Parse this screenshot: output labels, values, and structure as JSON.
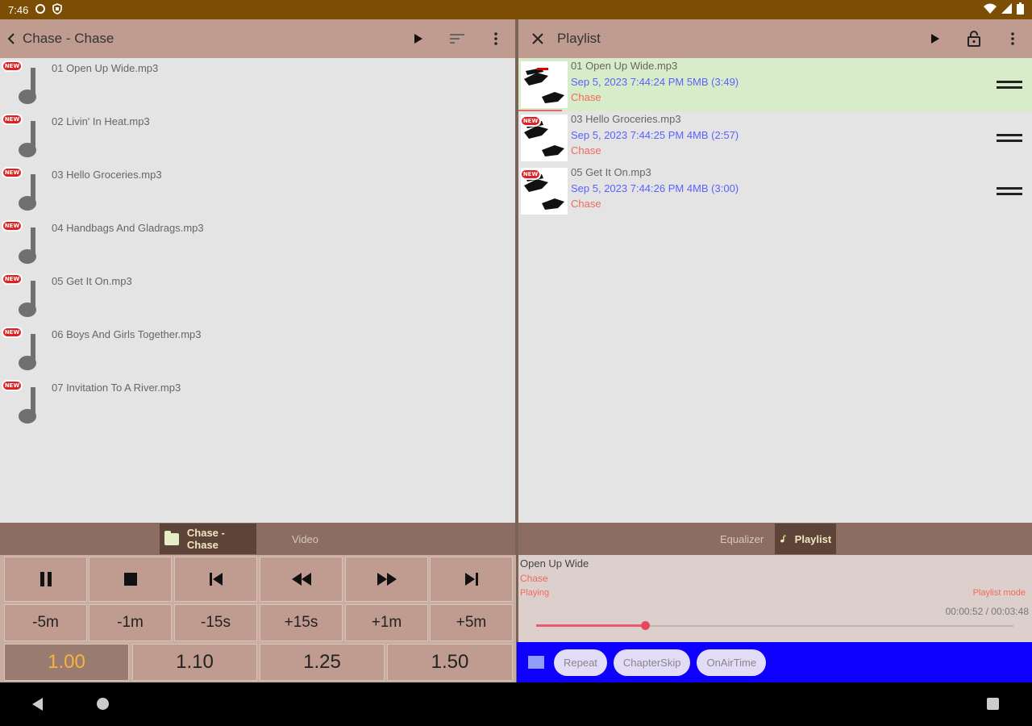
{
  "status_bar": {
    "time": "7:46"
  },
  "left_pane": {
    "title": "Chase - Chase",
    "tracks": [
      {
        "name": "01 Open Up Wide.mp3",
        "badge": "NEW"
      },
      {
        "name": "02 Livin' In Heat.mp3",
        "badge": "NEW"
      },
      {
        "name": "03 Hello Groceries.mp3",
        "badge": "NEW"
      },
      {
        "name": "04 Handbags And Gladrags.mp3",
        "badge": "NEW"
      },
      {
        "name": "05 Get It On.mp3",
        "badge": "NEW"
      },
      {
        "name": "06 Boys And Girls Together.mp3",
        "badge": "NEW"
      },
      {
        "name": "07 Invitation To A River.mp3",
        "badge": "NEW"
      }
    ],
    "tabs": [
      {
        "label": "Chase - Chase",
        "active": true
      },
      {
        "label": "Video",
        "active": false
      }
    ]
  },
  "right_pane": {
    "title": "Playlist",
    "items": [
      {
        "name": "01 Open Up Wide.mp3",
        "meta": "Sep 5, 2023 7:44:24 PM 5MB (3:49)",
        "artist": "Chase",
        "current": true,
        "badge": ""
      },
      {
        "name": "03 Hello Groceries.mp3",
        "meta": "Sep 5, 2023 7:44:25 PM 4MB (2:57)",
        "artist": "Chase",
        "current": false,
        "badge": "NEW"
      },
      {
        "name": "05 Get It On.mp3",
        "meta": "Sep 5, 2023 7:44:26 PM 4MB (3:00)",
        "artist": "Chase",
        "current": false,
        "badge": "NEW"
      }
    ],
    "tabs": [
      {
        "label": "Equalizer",
        "active": false
      },
      {
        "label": "Playlist",
        "active": true
      }
    ]
  },
  "controls": {
    "skip": [
      "-5m",
      "-1m",
      "-15s",
      "+15s",
      "+1m",
      "+5m"
    ],
    "speeds": [
      "1.00",
      "1.10",
      "1.25",
      "1.50"
    ],
    "active_speed": "1.00"
  },
  "player": {
    "song": "Open Up Wide",
    "artist": "Chase",
    "status": "Playing",
    "mode": "Playlist mode",
    "time": "00:00:52 / 00:03:48",
    "progress": 0.2281
  },
  "chips": [
    "Repeat",
    "ChapterSkip",
    "OnAirTime"
  ],
  "colors": {
    "status_bar": "#7c4e05",
    "toolbar": "#c09c90",
    "current_row": "#d9ecc9",
    "chip_bar": "#0e00ff",
    "accent_red": "#ef6a5a",
    "meta_blue": "#5a62ff",
    "active_speed": "#f5b342"
  },
  "icons": {
    "status": [
      "sync-icon",
      "shield-icon",
      "wifi-icon",
      "signal-icon",
      "battery-icon"
    ],
    "left_toolbar": [
      "back-arrow-icon",
      "play-icon",
      "sort-icon",
      "more-vert-icon"
    ],
    "right_toolbar": [
      "close-icon",
      "play-icon",
      "lock-open-icon",
      "more-vert-icon"
    ],
    "transport": [
      "pause-icon",
      "stop-icon",
      "skip-previous-icon",
      "rewind-icon",
      "fast-forward-icon",
      "skip-next-icon"
    ],
    "nav": [
      "nav-back-icon",
      "nav-home-icon",
      "nav-recents-icon"
    ]
  }
}
